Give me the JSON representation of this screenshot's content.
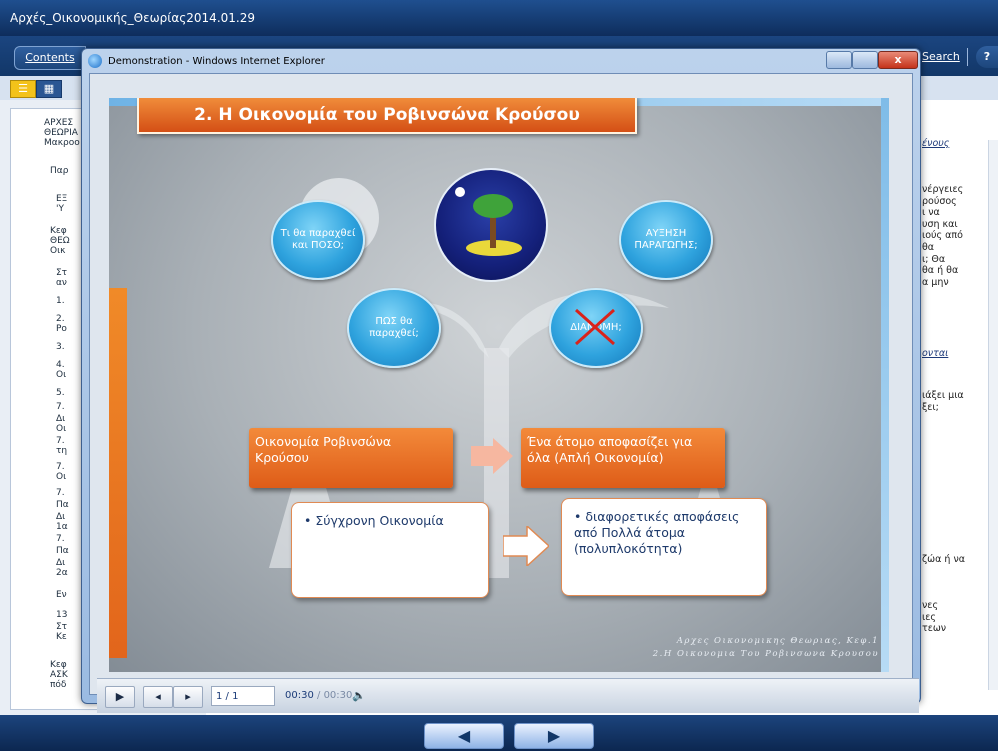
{
  "app": {
    "title": "Αρχές_Οικονομικής_Θεωρίας2014.01.29",
    "contents_tab": "Contents",
    "search_link": "Search",
    "help_label": "?",
    "view_list_icon": "list-icon",
    "view_grid_icon": "grid-icon"
  },
  "toc": {
    "items": [
      {
        "label": "ΑΡΧΕΣ"
      },
      {
        "label": "ΘΕΩΡΙΑ"
      },
      {
        "label": "Μακροο"
      },
      {
        "label": "Παρ"
      },
      {
        "label": "ΕΞ"
      },
      {
        "label": "'Υ"
      },
      {
        "label": "Κεφ"
      },
      {
        "label": "ΘΕΩ"
      },
      {
        "label": "Οικ"
      },
      {
        "label": "Στ"
      },
      {
        "label": "αν"
      },
      {
        "label": "1."
      },
      {
        "label": "2."
      },
      {
        "label": "Ρο"
      },
      {
        "label": "3."
      },
      {
        "label": "4."
      },
      {
        "label": "Οι"
      },
      {
        "label": "5."
      },
      {
        "label": "7."
      },
      {
        "label": "Δι"
      },
      {
        "label": "Οι"
      },
      {
        "label": "7."
      },
      {
        "label": "τη"
      },
      {
        "label": "7."
      },
      {
        "label": "Οι"
      },
      {
        "label": "7."
      },
      {
        "label": "Πα"
      },
      {
        "label": "Δι"
      },
      {
        "label": "1α"
      },
      {
        "label": "7."
      },
      {
        "label": "Πα"
      },
      {
        "label": "Δι"
      },
      {
        "label": "2α"
      },
      {
        "label": "Εν"
      },
      {
        "label": "13"
      },
      {
        "label": "Στ"
      },
      {
        "label": "Κε"
      },
      {
        "label": "Κεφ"
      },
      {
        "label": "ΑΣΚ"
      },
      {
        "label": "πόδ"
      }
    ]
  },
  "right_panel": {
    "link1": "ένους",
    "lines1": [
      "νέργειες",
      "ρούσος",
      "ι να",
      "υση και",
      "ιούς από",
      "θα",
      "ι; Θα",
      "θα ή θα",
      "α μην"
    ],
    "link2": "ονται",
    "lines2": [
      "ιάξει μια",
      "ξει;"
    ],
    "line3": "ζώα ή να",
    "lines4": [
      "νες",
      "ιες",
      "τεων"
    ]
  },
  "ie": {
    "title": "Demonstration - Windows Internet Explorer",
    "icon": "ie-icon",
    "close_label": "x"
  },
  "slide": {
    "title": "2. Η Οικονομία του Ροβινσώνα Κρούσου",
    "bubbles": {
      "what": "Τι θα παραχθεί και ΠΟΣΟ;",
      "how": "ΠΩΣ θα παραχθεί;",
      "growth": "ΑΥΞΗΣΗ ΠΑΡΑΓΩΓΗΣ;",
      "distribution": "ΔΙΑΝΟΜΗ;"
    },
    "box1_left": "Οικονομία Ροβινσώνα Κρούσου",
    "box1_right": "Ένα άτομο αποφασίζει για όλα (Απλή Οικονομία)",
    "box2_left": "• Σύγχρονη Οικονομία",
    "box2_right": "• διαφορετικές αποφάσεις από Πολλά άτομα (πολυπλοκότητα)",
    "footer_line1": "Αρχες Οικονομικης Θεωριας, Κεφ.1",
    "footer_line2": "2.Η Οικονομια Του Ροβινσωνα Κρουσου"
  },
  "player": {
    "counter": "1 / 1",
    "time_current": "00:30",
    "time_total": "/ 00:30",
    "play_icon": "play-icon",
    "prev_icon": "prev-icon",
    "next_icon": "next-icon",
    "volume_icon": "volume-icon"
  },
  "bottom_nav": {
    "prev_icon": "arrow-left-icon",
    "next_icon": "arrow-right-icon"
  }
}
